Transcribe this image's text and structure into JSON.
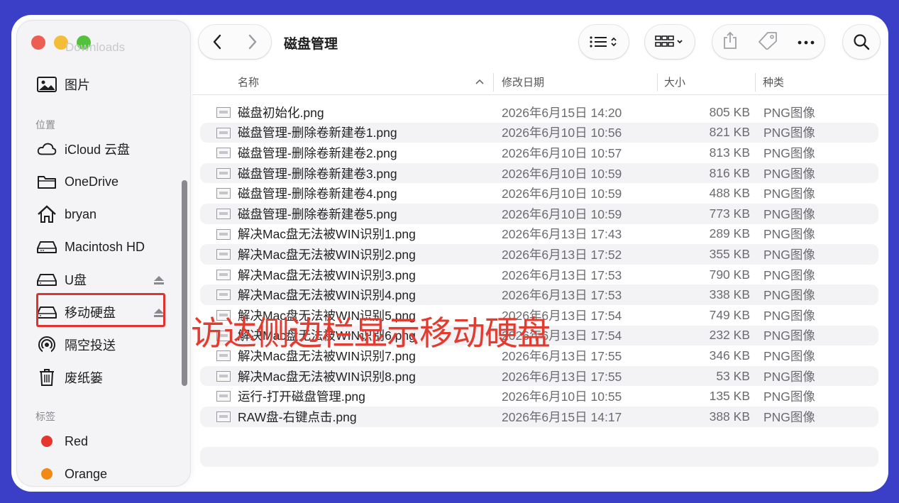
{
  "sidebar": {
    "ghost_item": "Downloads",
    "items_top": [
      {
        "label": "图片",
        "icon": "photo-icon"
      }
    ],
    "section_location": "位置",
    "locations": [
      {
        "label": "iCloud 云盘",
        "icon": "cloud-icon"
      },
      {
        "label": "OneDrive",
        "icon": "folder-icon"
      },
      {
        "label": "bryan",
        "icon": "home-icon"
      },
      {
        "label": "Macintosh HD",
        "icon": "drive-icon"
      },
      {
        "label": "U盘",
        "icon": "drive-icon"
      },
      {
        "label": "移动硬盘",
        "icon": "drive-icon"
      },
      {
        "label": "隔空投送",
        "icon": "airdrop-icon"
      },
      {
        "label": "废纸篓",
        "icon": "trash-icon"
      }
    ],
    "section_tags": "标签",
    "tags": [
      {
        "label": "Red",
        "color": "#e5352c"
      },
      {
        "label": "Orange",
        "color": "#f08a14"
      }
    ]
  },
  "toolbar": {
    "title": "磁盘管理"
  },
  "columns": {
    "name": "名称",
    "date": "修改日期",
    "size": "大小",
    "kind": "种类"
  },
  "files": [
    {
      "name": "磁盘初始化.png",
      "date": "2026年6月15日 14:20",
      "size": "805 KB",
      "kind": "PNG图像"
    },
    {
      "name": "磁盘管理-删除卷新建卷1.png",
      "date": "2026年6月10日 10:56",
      "size": "821 KB",
      "kind": "PNG图像"
    },
    {
      "name": "磁盘管理-删除卷新建卷2.png",
      "date": "2026年6月10日 10:57",
      "size": "813 KB",
      "kind": "PNG图像"
    },
    {
      "name": "磁盘管理-删除卷新建卷3.png",
      "date": "2026年6月10日 10:59",
      "size": "816 KB",
      "kind": "PNG图像"
    },
    {
      "name": "磁盘管理-删除卷新建卷4.png",
      "date": "2026年6月10日 10:59",
      "size": "488 KB",
      "kind": "PNG图像"
    },
    {
      "name": "磁盘管理-删除卷新建卷5.png",
      "date": "2026年6月10日 10:59",
      "size": "773 KB",
      "kind": "PNG图像"
    },
    {
      "name": "解决Mac盘无法被WIN识别1.png",
      "date": "2026年6月13日 17:43",
      "size": "289 KB",
      "kind": "PNG图像"
    },
    {
      "name": "解决Mac盘无法被WIN识别2.png",
      "date": "2026年6月13日 17:52",
      "size": "355 KB",
      "kind": "PNG图像"
    },
    {
      "name": "解决Mac盘无法被WIN识别3.png",
      "date": "2026年6月13日 17:53",
      "size": "790 KB",
      "kind": "PNG图像"
    },
    {
      "name": "解决Mac盘无法被WIN识别4.png",
      "date": "2026年6月13日 17:53",
      "size": "338 KB",
      "kind": "PNG图像"
    },
    {
      "name": "解决Mac盘无法被WIN识别5.png",
      "date": "2026年6月13日 17:54",
      "size": "749 KB",
      "kind": "PNG图像"
    },
    {
      "name": "解决Mac盘无法被WIN识别6.png",
      "date": "2026年6月13日 17:54",
      "size": "232 KB",
      "kind": "PNG图像"
    },
    {
      "name": "解决Mac盘无法被WIN识别7.png",
      "date": "2026年6月13日 17:55",
      "size": "346 KB",
      "kind": "PNG图像"
    },
    {
      "name": "解决Mac盘无法被WIN识别8.png",
      "date": "2026年6月13日 17:55",
      "size": "53 KB",
      "kind": "PNG图像"
    },
    {
      "name": "运行-打开磁盘管理.png",
      "date": "2026年6月10日 10:55",
      "size": "135 KB",
      "kind": "PNG图像"
    },
    {
      "name": "RAW盘-右键点击.png",
      "date": "2026年6月15日 14:17",
      "size": "388 KB",
      "kind": "PNG图像"
    }
  ],
  "annotation": {
    "text": "访达侧边栏显示移动硬盘",
    "color": "#e23b30"
  }
}
